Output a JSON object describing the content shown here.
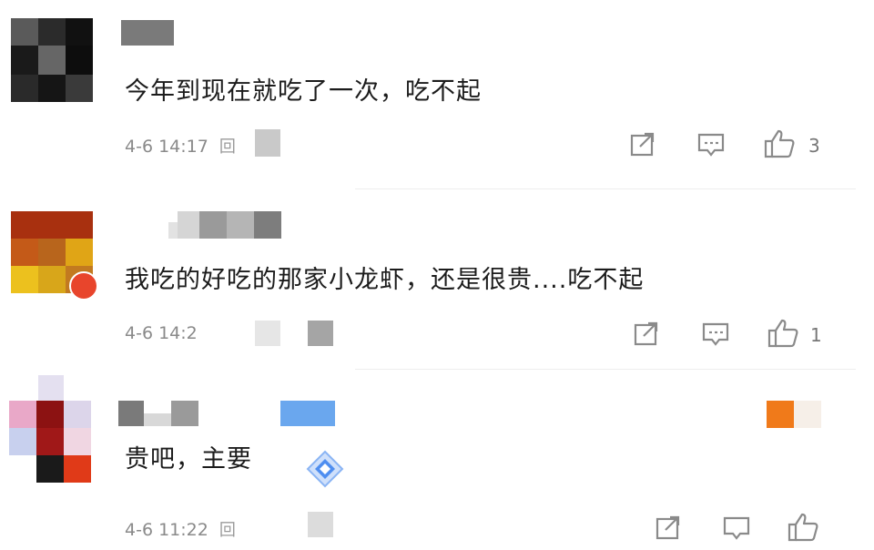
{
  "comments": [
    {
      "text": "今年到现在就吃了一次，吃不起",
      "time": "4-6 14:17",
      "reply_partial": "回",
      "likes": "3",
      "icons": [
        "share-icon",
        "comment-icon",
        "like-icon"
      ]
    },
    {
      "text": "我吃的好吃的那家小龙虾，还是很贵....吃不起",
      "time": "4-6 14:2",
      "likes": "1",
      "icons": [
        "share-icon",
        "comment-icon",
        "like-icon"
      ]
    },
    {
      "text": "贵吧，主要",
      "time": "4-6 11:22",
      "reply_partial": "回",
      "icons": [
        "share-icon",
        "comment-icon",
        "like-icon"
      ]
    }
  ],
  "colors": {
    "icon_stroke": "#8a8a8a",
    "meta_text": "#8a8a8a",
    "badge_red": "#e8452c",
    "badge_orange": "#f07a1a",
    "badge_blue": "#6aa7ee"
  }
}
